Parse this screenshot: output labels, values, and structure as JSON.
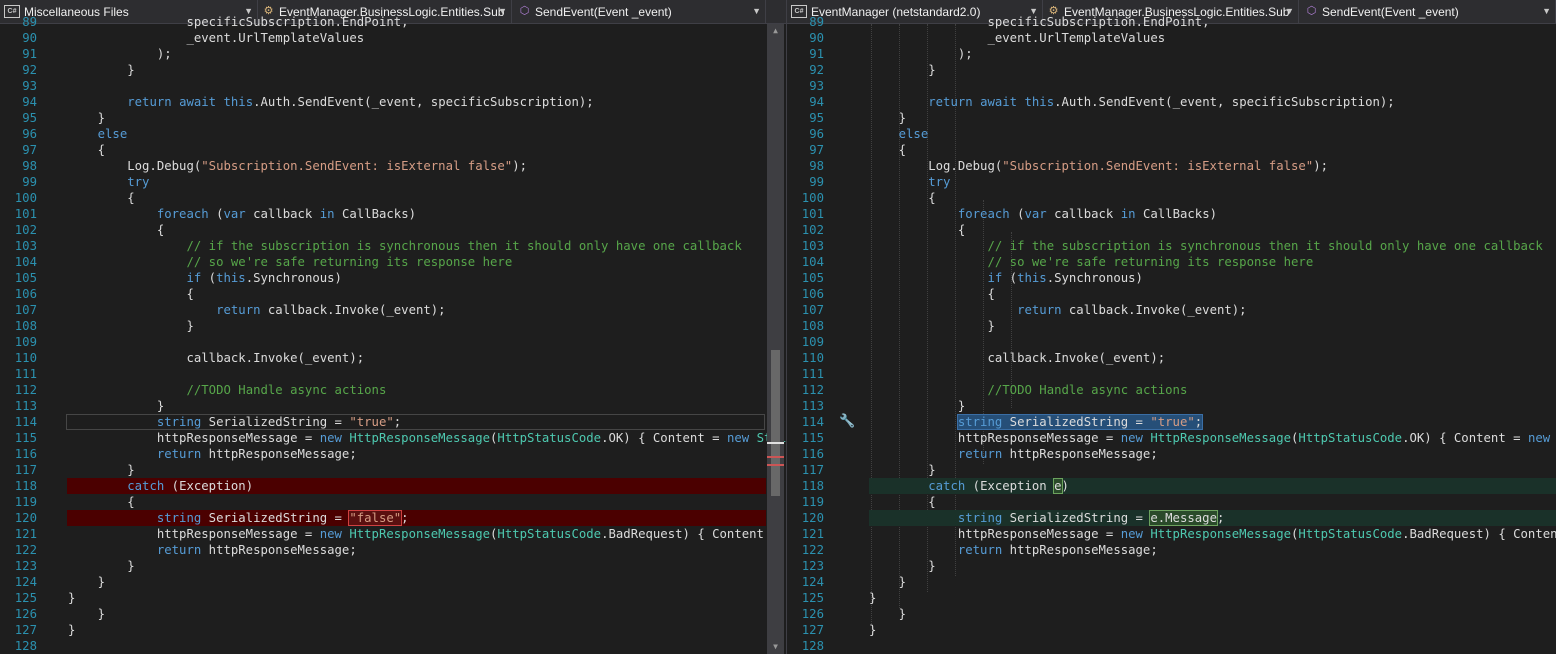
{
  "left_pane": {
    "nav": {
      "project": "Miscellaneous Files",
      "type": "EventManager.BusinessLogic.Entities.Sub",
      "member": "SendEvent(Event _event)"
    },
    "lines": [
      {
        "n": "89",
        "t": "                specificSubscription.EndPoint,"
      },
      {
        "n": "90",
        "t": "                _event.UrlTemplateValues"
      },
      {
        "n": "91",
        "t": "            );"
      },
      {
        "n": "92",
        "t": "        }"
      },
      {
        "n": "93",
        "t": ""
      },
      {
        "n": "94",
        "t": "        return await this.Auth.SendEvent(_event, specificSubscription);"
      },
      {
        "n": "95",
        "t": "    }"
      },
      {
        "n": "96",
        "t": "    else"
      },
      {
        "n": "97",
        "t": "    {"
      },
      {
        "n": "98",
        "t": "        Log.Debug(\"Subscription.SendEvent: isExternal false\");"
      },
      {
        "n": "99",
        "t": "        try"
      },
      {
        "n": "100",
        "t": "        {"
      },
      {
        "n": "101",
        "t": "            foreach (var callback in CallBacks)"
      },
      {
        "n": "102",
        "t": "            {"
      },
      {
        "n": "103",
        "t": "                // if the subscription is synchronous then it should only have one callback"
      },
      {
        "n": "104",
        "t": "                // so we're safe returning its response here"
      },
      {
        "n": "105",
        "t": "                if (this.Synchronous)"
      },
      {
        "n": "106",
        "t": "                {"
      },
      {
        "n": "107",
        "t": "                    return callback.Invoke(_event);"
      },
      {
        "n": "108",
        "t": "                }"
      },
      {
        "n": "109",
        "t": ""
      },
      {
        "n": "110",
        "t": "                callback.Invoke(_event);"
      },
      {
        "n": "111",
        "t": ""
      },
      {
        "n": "112",
        "t": "                //TODO Handle async actions"
      },
      {
        "n": "113",
        "t": "            }"
      },
      {
        "n": "114",
        "t": "            string SerializedString = \"true\";"
      },
      {
        "n": "115",
        "t": "            httpResponseMessage = new HttpResponseMessage(HttpStatusCode.OK) { Content = new StringContent(SerializedString) };"
      },
      {
        "n": "116",
        "t": "            return httpResponseMessage;"
      },
      {
        "n": "117",
        "t": "        }"
      },
      {
        "n": "118",
        "t": "        catch (Exception)"
      },
      {
        "n": "119",
        "t": "        {"
      },
      {
        "n": "120",
        "t": "            string SerializedString = \"false\";"
      },
      {
        "n": "121",
        "t": "            httpResponseMessage = new HttpResponseMessage(HttpStatusCode.BadRequest) { Content = new StringContent(SerializedString) };"
      },
      {
        "n": "122",
        "t": "            return httpResponseMessage;"
      },
      {
        "n": "123",
        "t": "        }"
      },
      {
        "n": "124",
        "t": "    }"
      },
      {
        "n": "125",
        "t": "}"
      },
      {
        "n": "126",
        "t": "    }"
      },
      {
        "n": "127",
        "t": "}"
      },
      {
        "n": "128",
        "t": ""
      }
    ]
  },
  "right_pane": {
    "nav": {
      "project": "EventManager (netstandard2.0)",
      "type": "EventManager.BusinessLogic.Entities.Sub",
      "member": "SendEvent(Event _event)"
    },
    "lines": [
      {
        "n": "89",
        "t": "                specificSubscription.EndPoint,"
      },
      {
        "n": "90",
        "t": "                _event.UrlTemplateValues"
      },
      {
        "n": "91",
        "t": "            );"
      },
      {
        "n": "92",
        "t": "        }"
      },
      {
        "n": "93",
        "t": ""
      },
      {
        "n": "94",
        "t": "        return await this.Auth.SendEvent(_event, specificSubscription);"
      },
      {
        "n": "95",
        "t": "    }"
      },
      {
        "n": "96",
        "t": "    else"
      },
      {
        "n": "97",
        "t": "    {"
      },
      {
        "n": "98",
        "t": "        Log.Debug(\"Subscription.SendEvent: isExternal false\");"
      },
      {
        "n": "99",
        "t": "        try"
      },
      {
        "n": "100",
        "t": "        {"
      },
      {
        "n": "101",
        "t": "            foreach (var callback in CallBacks)"
      },
      {
        "n": "102",
        "t": "            {"
      },
      {
        "n": "103",
        "t": "                // if the subscription is synchronous then it should only have one callback"
      },
      {
        "n": "104",
        "t": "                // so we're safe returning its response here"
      },
      {
        "n": "105",
        "t": "                if (this.Synchronous)"
      },
      {
        "n": "106",
        "t": "                {"
      },
      {
        "n": "107",
        "t": "                    return callback.Invoke(_event);"
      },
      {
        "n": "108",
        "t": "                }"
      },
      {
        "n": "109",
        "t": ""
      },
      {
        "n": "110",
        "t": "                callback.Invoke(_event);"
      },
      {
        "n": "111",
        "t": ""
      },
      {
        "n": "112",
        "t": "                //TODO Handle async actions"
      },
      {
        "n": "113",
        "t": "            }"
      },
      {
        "n": "114",
        "t": "            string SerializedString = \"true\";"
      },
      {
        "n": "115",
        "t": "            httpResponseMessage = new HttpResponseMessage(HttpStatusCode.OK) { Content = new StringContent(SerializedString) };"
      },
      {
        "n": "116",
        "t": "            return httpResponseMessage;"
      },
      {
        "n": "117",
        "t": "        }"
      },
      {
        "n": "118",
        "t": "        catch (Exception e)"
      },
      {
        "n": "119",
        "t": "        {"
      },
      {
        "n": "120",
        "t": "            string SerializedString = e.Message;"
      },
      {
        "n": "121",
        "t": "            httpResponseMessage = new HttpResponseMessage(HttpStatusCode.BadRequest) { Content = new StringContent(SerializedString) };"
      },
      {
        "n": "122",
        "t": "            return httpResponseMessage;"
      },
      {
        "n": "123",
        "t": "        }"
      },
      {
        "n": "124",
        "t": "    }"
      },
      {
        "n": "125",
        "t": "}"
      },
      {
        "n": "126",
        "t": "    }"
      },
      {
        "n": "127",
        "t": "}"
      },
      {
        "n": "128",
        "t": ""
      }
    ]
  },
  "icons": {
    "project": "csharp-project-icon",
    "type": "class-icon",
    "member": "method-icon",
    "quick_action": "screwdriver-icon"
  },
  "colors": {
    "background": "#1e1e1e",
    "keyword": "#569cd6",
    "string": "#d69d85",
    "comment": "#57a64a",
    "type": "#4ec9b0",
    "line_number": "#2b91af",
    "deleted": "#4b0000",
    "added": "#1a3129"
  }
}
